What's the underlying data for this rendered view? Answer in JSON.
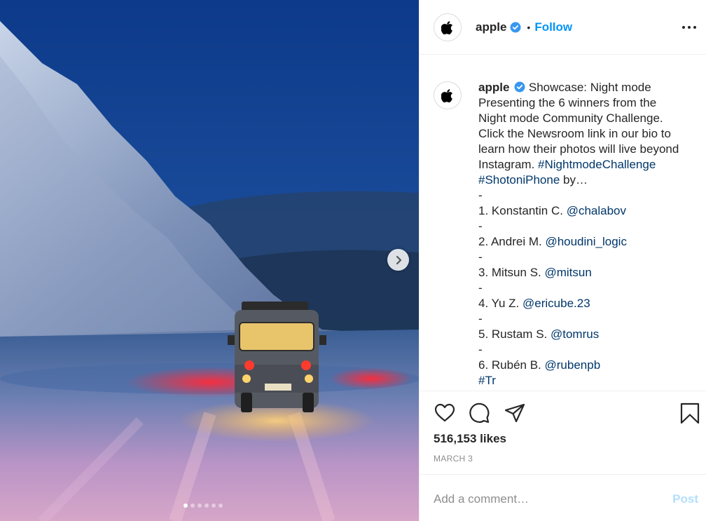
{
  "post": {
    "username": "apple",
    "follow_label": "Follow",
    "separator": "•",
    "caption": {
      "username": "apple",
      "lines": [
        "Showcase: Night mode",
        "Presenting the 6 winners from the",
        "Night mode Community Challenge.",
        "Click the Newsroom link in our bio to",
        "learn how their photos will live beyond",
        "Instagram."
      ],
      "hashtag1": "#NightmodeChallenge",
      "hashtag2": "#ShotoniPhone",
      "hashtag_suffix": " by…",
      "dash": "-",
      "winners": [
        {
          "prefix": "1. Konstantin C. ",
          "handle": "@chalabov"
        },
        {
          "prefix": "2. Andrei M. ",
          "handle": "@houdini_logic"
        },
        {
          "prefix": "3. Mitsun S. ",
          "handle": "@mitsun"
        },
        {
          "prefix": "4. Yu Z. ",
          "handle": "@ericube.23"
        },
        {
          "prefix": "5. Rustam S. ",
          "handle": "@tomrus"
        },
        {
          "prefix": "6. Rubén B. ",
          "handle": "@rubenpb"
        }
      ],
      "partial_tail": "#Tr"
    },
    "likes_text": "516,153 likes",
    "date_text": "MARCH 3",
    "comment_placeholder": "Add a comment…",
    "post_label": "Post"
  },
  "carousel": {
    "slide_count": 6,
    "active_index": 0
  },
  "icons": {
    "avatar": "apple-logo-icon",
    "verified": "verified-badge-icon",
    "more": "more-options-icon",
    "like": "heart-icon",
    "comment": "comment-bubble-icon",
    "share": "paper-plane-icon",
    "save": "bookmark-icon",
    "next": "chevron-right-icon"
  },
  "colors": {
    "link_blue": "#0095f6",
    "hashtag_blue": "#00376b",
    "verified_blue": "#3897f0",
    "text": "#262626",
    "muted": "#8e8e8e",
    "post_disabled": "#b2dffc"
  }
}
